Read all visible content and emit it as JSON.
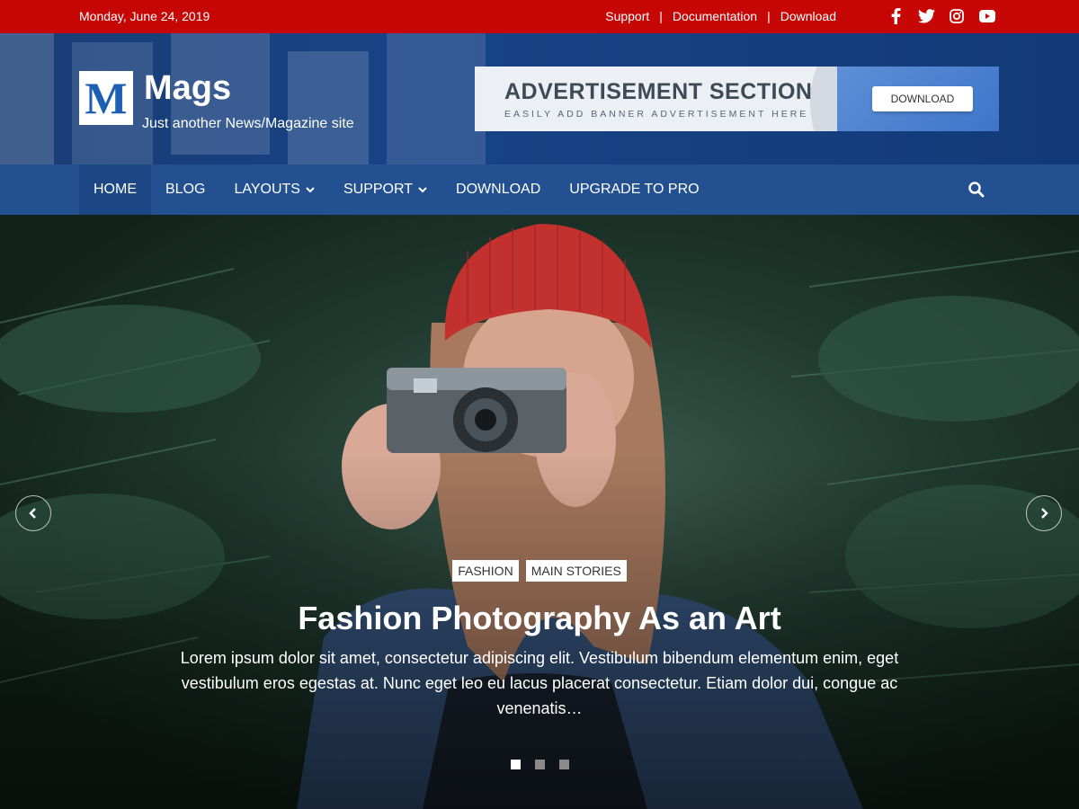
{
  "topbar": {
    "date": "Monday, June 24, 2019",
    "links": [
      {
        "label": "Support"
      },
      {
        "label": "Documentation"
      },
      {
        "label": "Download"
      }
    ],
    "separator": "|",
    "social_icons": [
      "facebook-icon",
      "twitter-icon",
      "instagram-icon",
      "youtube-icon"
    ],
    "background": "#c70606"
  },
  "header": {
    "logo_letter": "M",
    "title": "Mags",
    "tagline": "Just another News/Magazine site"
  },
  "ad": {
    "title": "ADVERTISEMENT SECTION",
    "subtitle": "EASILY ADD BANNER ADVERTISEMENT HERE",
    "button_label": "DOWNLOAD"
  },
  "nav": {
    "items": [
      {
        "label": "HOME",
        "active": true
      },
      {
        "label": "BLOG"
      },
      {
        "label": "LAYOUTS",
        "dropdown": true
      },
      {
        "label": "SUPPORT",
        "dropdown": true
      },
      {
        "label": "DOWNLOAD"
      },
      {
        "label": "UPGRADE TO PRO"
      }
    ],
    "search_icon": "search-icon",
    "background": "#235091"
  },
  "hero": {
    "categories": [
      "FASHION",
      "MAIN STORIES"
    ],
    "headline": "Fashion Photography As an Art",
    "excerpt": "Lorem ipsum dolor sit amet, consectetur adipiscing elit. Vestibulum bibendum elementum enim, eget vestibulum eros egestas at. Nunc eget leo eu lacus placerat consectetur. Etiam dolor dui, congue ac venenatis…",
    "slides": 3,
    "active_slide": 1
  }
}
